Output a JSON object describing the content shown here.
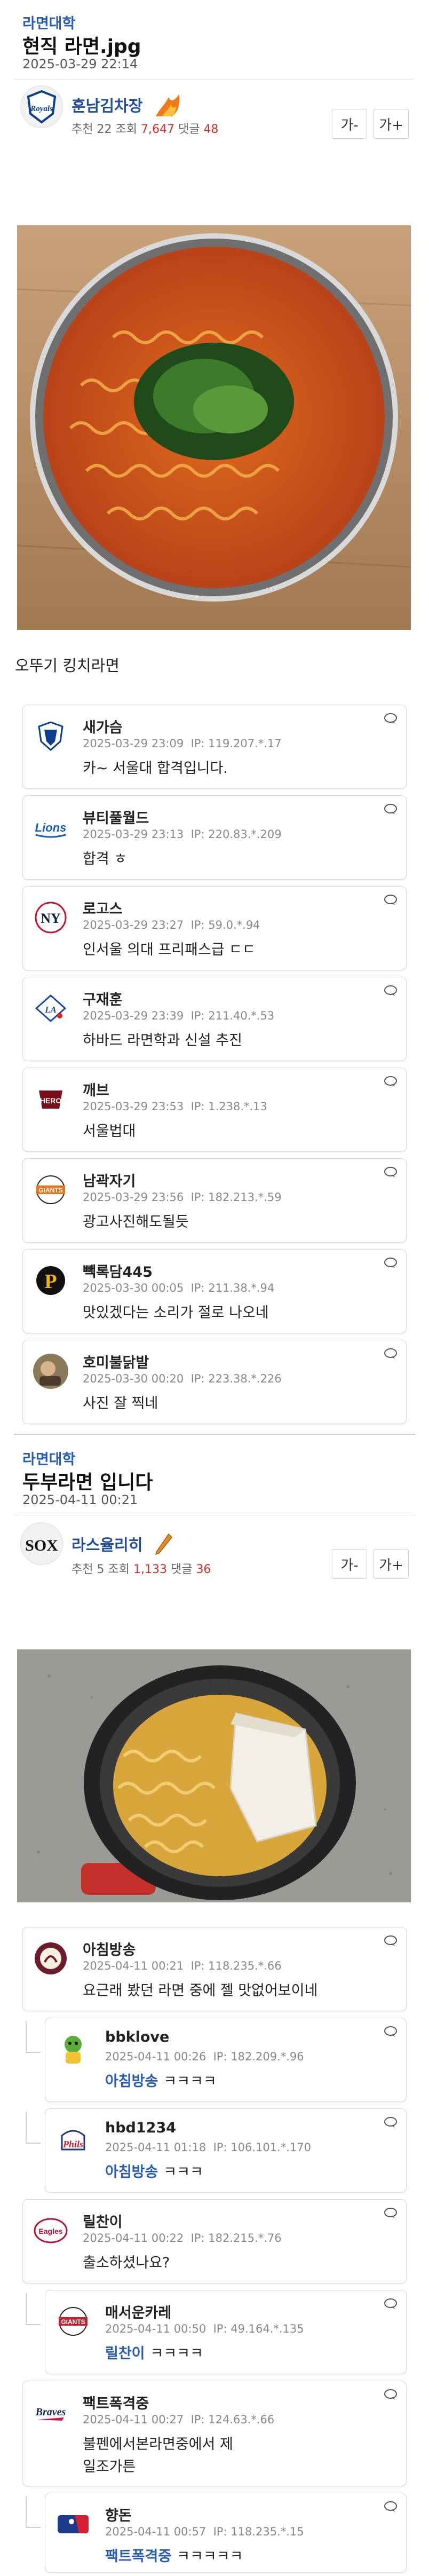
{
  "posts": [
    {
      "board": "라면대학",
      "title": "현직 라면.jpg",
      "date": "2025-03-29 22:14",
      "author": "훈남김차장",
      "stats": {
        "rec_label": "추천",
        "rec": "22",
        "view_label": "조회",
        "views": "7,647",
        "cmt_label": "댓글",
        "comments": "48"
      },
      "font_buttons": [
        "가-",
        "가+"
      ],
      "caption": "오뚜기 킹치라면",
      "comments": [
        {
          "nick": "새가슴",
          "date": "2025-03-29 23:09",
          "ip": "IP: 119.207.*.17",
          "text": "카~ 서울대 합격입니다.",
          "logo": "royals-logo"
        },
        {
          "nick": "뷰티풀월드",
          "date": "2025-03-29 23:13",
          "ip": "IP: 220.83.*.209",
          "text": "합격 ㅎ",
          "logo": "lions-logo"
        },
        {
          "nick": "로고스",
          "date": "2025-03-29 23:27",
          "ip": "IP: 59.0.*.94",
          "text": "인서울 의대 프리패스급 ㄷㄷ",
          "logo": "yankees-logo"
        },
        {
          "nick": "구재훈",
          "date": "2025-03-29 23:39",
          "ip": "IP: 211.40.*.53",
          "text": "하바드 라면학과 신설 추진",
          "logo": "dodgers-logo"
        },
        {
          "nick": "깨브",
          "date": "2025-03-29 23:53",
          "ip": "IP: 1.238.*.13",
          "text": "서울법대",
          "logo": "kiwoom-logo"
        },
        {
          "nick": "남곽자기",
          "date": "2025-03-29 23:56",
          "ip": "IP: 182.213.*.59",
          "text": "광고사진해도될듯",
          "logo": "giants-logo"
        },
        {
          "nick": "빽록담445",
          "date": "2025-03-30 00:05",
          "ip": "IP: 211.38.*.94",
          "text": "맛있겠다는 소리가 절로 나오네",
          "logo": "pirates-logo"
        },
        {
          "nick": "호미불닭발",
          "date": "2025-03-30 00:20",
          "ip": "IP: 223.38.*.226",
          "text": "사진 잘 찍네",
          "logo": "photo-avatar"
        }
      ]
    },
    {
      "board": "라면대학",
      "title": "두부라면 입니다",
      "date": "2025-04-11 00:21",
      "author": "라스율리히",
      "stats": {
        "rec_label": "추천",
        "rec": "5",
        "view_label": "조회",
        "views": "1,133",
        "cmt_label": "댓글",
        "comments": "36"
      },
      "font_buttons": [
        "가-",
        "가+"
      ],
      "comments": [
        {
          "nick": "아침방송",
          "date": "2025-04-11 00:21",
          "ip": "IP: 118.235.*.66",
          "text": "요근래 봤던 라면 중에 젤 맛없어보이네",
          "logo": "wyverns-logo",
          "reply": false
        },
        {
          "nick": "bbklove",
          "date": "2025-04-11 00:26",
          "ip": "IP: 182.209.*.96",
          "mention": "아침방송",
          "text": "ㅋㅋㅋㅋ",
          "logo": "mascot-logo",
          "reply": true
        },
        {
          "nick": "hbd1234",
          "date": "2025-04-11 01:18",
          "ip": "IP: 106.101.*.170",
          "mention": "아침방송",
          "text": "ㅋㅋㅋ",
          "logo": "phillies-logo",
          "reply": true
        },
        {
          "nick": "릴찬이",
          "date": "2025-04-11 00:22",
          "ip": "IP: 182.215.*.76",
          "text": "출소하셨나요?",
          "logo": "eagles-logo",
          "reply": false
        },
        {
          "nick": "매서운카레",
          "date": "2025-04-11 00:50",
          "ip": "IP: 49.164.*.135",
          "mention": "릴찬이",
          "text": "ㅋㅋㅋㅋ",
          "logo": "giants2-logo",
          "reply": true
        },
        {
          "nick": "팩트폭격중",
          "date": "2025-04-11 00:27",
          "ip": "IP: 124.63.*.66",
          "text": "불펜에서본라면중에서 제일조가튼",
          "logo": "braves-logo",
          "reply": false
        },
        {
          "nick": "향돈",
          "date": "2025-04-11 00:57",
          "ip": "IP: 118.235.*.15",
          "mention": "팩트폭격중",
          "text": "ㅋㅋㅋㅋㅋ",
          "logo": "mlb-logo",
          "reply": true
        }
      ]
    }
  ],
  "colors": {
    "board": "#2a5db0",
    "highlight": "#d2322d",
    "author": "#234e9b"
  }
}
